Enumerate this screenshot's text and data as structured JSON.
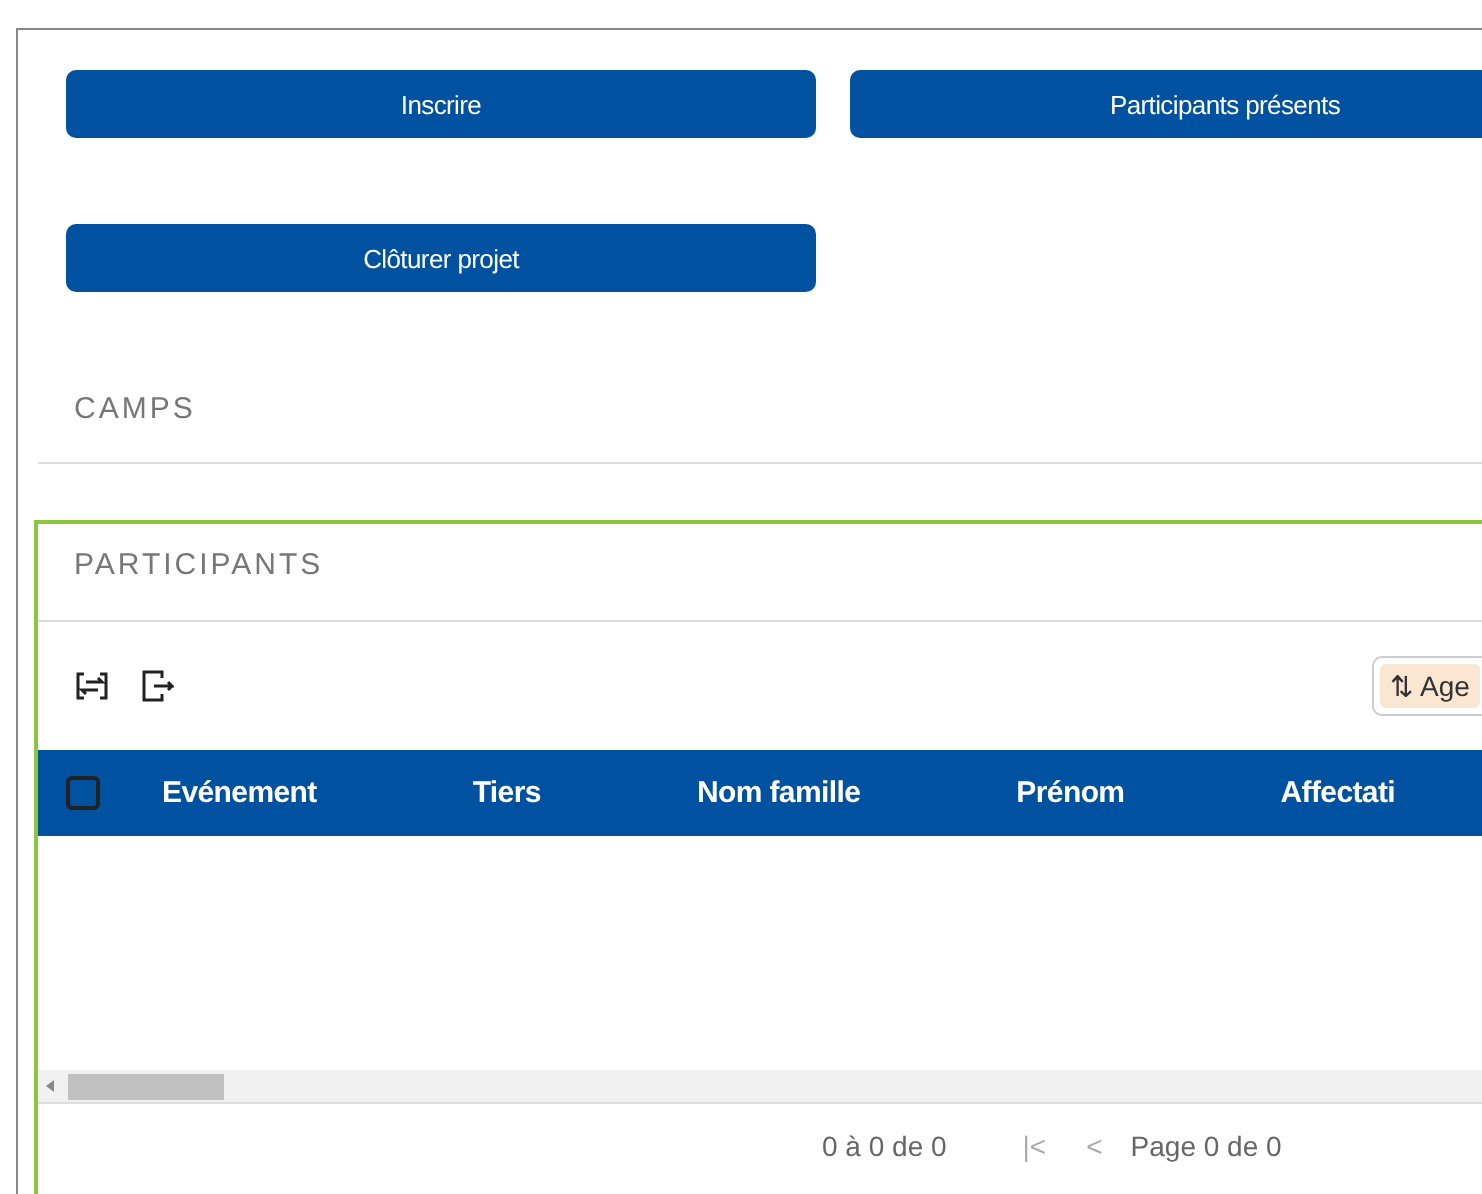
{
  "buttons": [
    {
      "label": "Inscrire"
    },
    {
      "label": "Participants présents"
    },
    {
      "label": "Clôturer projet"
    }
  ],
  "camps": {
    "title": "CAMPS"
  },
  "participants": {
    "title": "PARTICIPANTS",
    "sort_chip": {
      "icon": "⇅",
      "label": "Age"
    },
    "table": {
      "select_all_checked": false,
      "columns": [
        "Evénement",
        "Tiers",
        "Nom famille",
        "Prénom",
        "Affectati"
      ]
    },
    "pagination": {
      "range": "0 à 0 de 0",
      "first": "|<",
      "prev": "<",
      "page": "Page 0 de 0"
    }
  }
}
